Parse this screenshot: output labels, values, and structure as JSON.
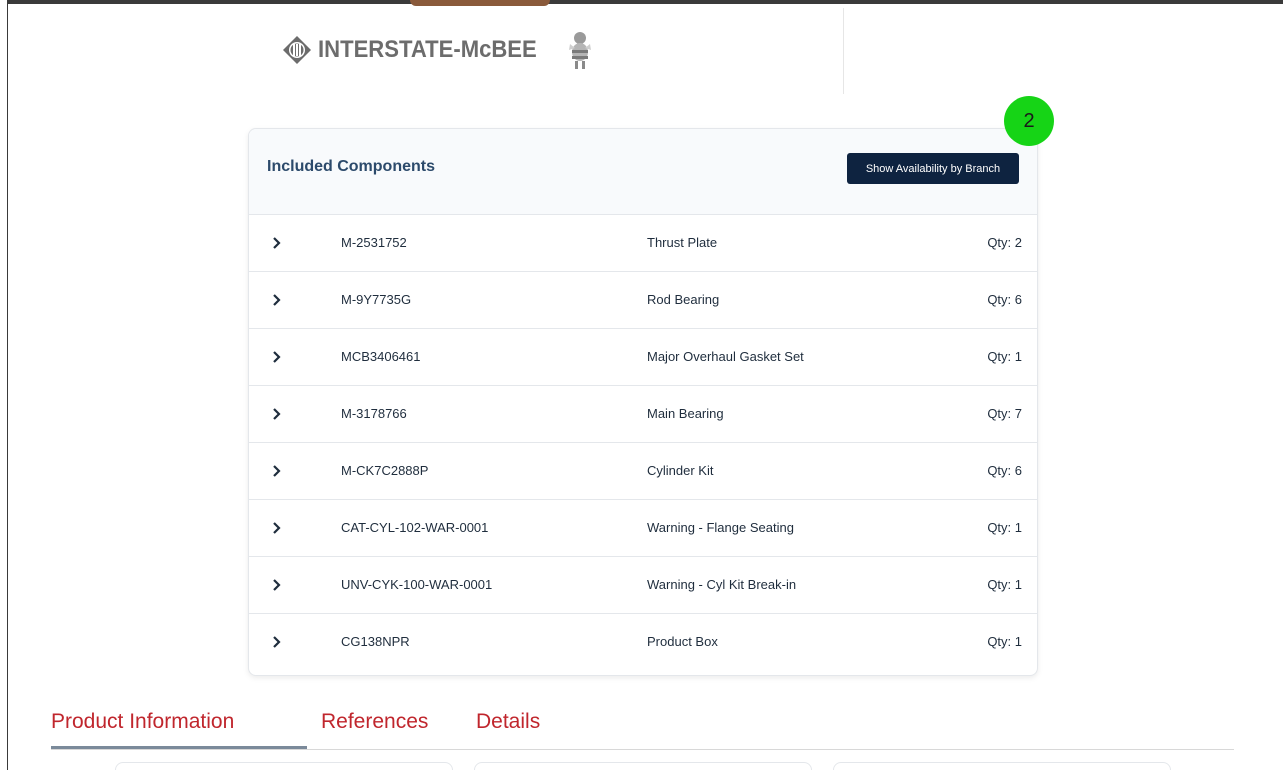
{
  "logo": {
    "text": "INTERSTATE-McBEE"
  },
  "step_badge": "2",
  "components": {
    "title": "Included Components",
    "availability_button": "Show Availability by Branch",
    "rows": [
      {
        "part": "M-2531752",
        "description": "Thrust Plate",
        "qty": "Qty: 2"
      },
      {
        "part": "M-9Y7735G",
        "description": "Rod Bearing",
        "qty": "Qty: 6"
      },
      {
        "part": "MCB3406461",
        "description": "Major Overhaul Gasket Set",
        "qty": "Qty: 1"
      },
      {
        "part": "M-3178766",
        "description": "Main Bearing",
        "qty": "Qty: 7"
      },
      {
        "part": "M-CK7C2888P",
        "description": "Cylinder Kit",
        "qty": "Qty: 6"
      },
      {
        "part": "CAT-CYL-102-WAR-0001",
        "description": "Warning - Flange Seating",
        "qty": "Qty: 1"
      },
      {
        "part": "UNV-CYK-100-WAR-0001",
        "description": "Warning - Cyl Kit Break-in",
        "qty": "Qty: 1"
      },
      {
        "part": "CG138NPR",
        "description": "Product Box",
        "qty": "Qty: 1"
      }
    ]
  },
  "tabs": [
    {
      "label": "Product Information",
      "active": true
    },
    {
      "label": "References",
      "active": false
    },
    {
      "label": "Details",
      "active": false
    }
  ],
  "colors": {
    "brand_navy": "#0e2340",
    "title_blue": "#2c4a6b",
    "tab_red": "#c0262d",
    "badge_green": "#16d416"
  },
  "icons": {
    "row_expand": "chevron-right-icon",
    "logo_mark": "interstate-emblem-icon",
    "logo_mascot": "mcbee-mascot-icon"
  }
}
